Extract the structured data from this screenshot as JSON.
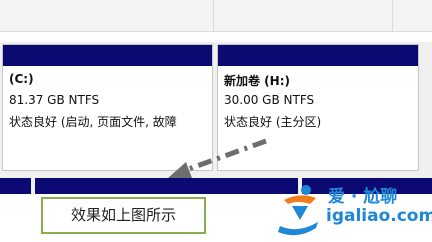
{
  "partitions": [
    {
      "name": "(C:)",
      "size": "81.37 GB NTFS",
      "status": "状态良好 (启动, 页面文件, 故障"
    },
    {
      "name": "新加卷 (H:)",
      "size": "30.00 GB NTFS",
      "status": "状态良好 (主分区)"
    }
  ],
  "caption": "效果如上图所示",
  "watermark": {
    "title": "爱 · 尬聊",
    "url": "igaliao.com"
  },
  "colors": {
    "header_bar": "#0b0a72",
    "caption_border": "#86b04e",
    "arrow": "#6e6e6e",
    "watermark_blue": "#1e87d6",
    "watermark_orange": "#f07c1c"
  },
  "icons": [
    "dashed-arrow-icon",
    "igaliao-logo-icon"
  ]
}
